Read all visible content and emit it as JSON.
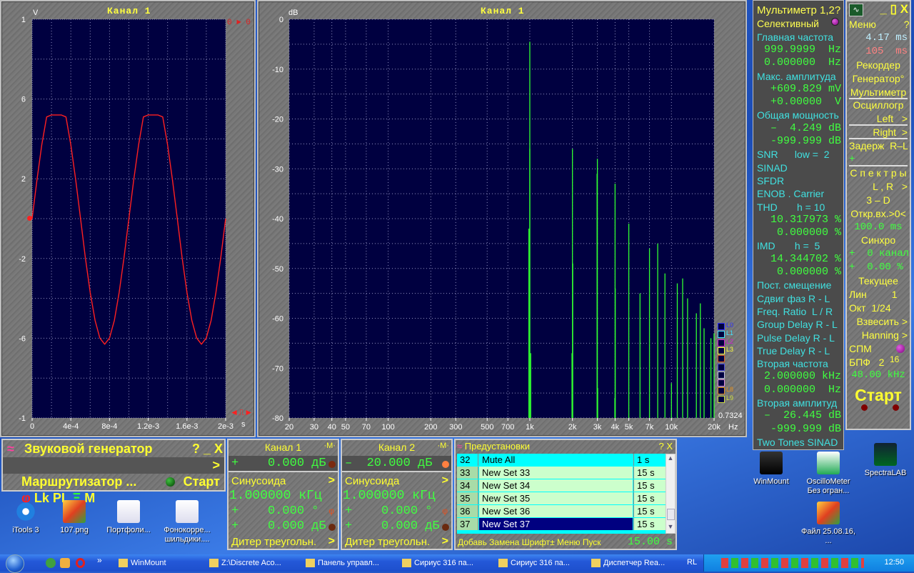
{
  "oscilloscope": {
    "title": "Канал 1",
    "y_unit": "V",
    "x_unit": "s",
    "marker_top": "0 ► 0",
    "marker_bottom": "◄⎍►",
    "trace_color": "#ff2020"
  },
  "spectrum": {
    "title": "Канал 1",
    "y_unit": "dB",
    "x_unit": "Hz",
    "legend": [
      {
        "label": "L0",
        "color": "#3030ff"
      },
      {
        "label": "L1",
        "color": "#40e0ff"
      },
      {
        "label": "L2",
        "color": "#d020d0"
      },
      {
        "label": "L3",
        "color": "#ffff40"
      },
      {
        "label": "",
        "color": "#e06020"
      },
      {
        "label": "",
        "color": "#5050e0"
      },
      {
        "label": "",
        "color": "#c0c0e0"
      },
      {
        "label": "",
        "color": "#e090e0"
      },
      {
        "label": "L8",
        "color": "#e09020"
      },
      {
        "label": "L9",
        "color": "#d0e040"
      }
    ],
    "readout": "0.7324",
    "trace_color": "#30ff30"
  },
  "chart_data": [
    {
      "type": "line",
      "title": "Канал 1",
      "ylabel": "V",
      "xlabel": "s",
      "xlim": [
        0,
        0.002
      ],
      "ylim": [
        -1,
        1
      ],
      "grid": true,
      "x_ticks": [
        "0",
        "4e-4",
        "8e-4",
        "1.2e-3",
        "1.6e-3",
        "2e-3"
      ],
      "x_tick_values": [
        0,
        0.0004,
        0.0008,
        0.0012,
        0.0016,
        0.002
      ],
      "y_ticks": [
        "1",
        "6",
        "2",
        "-2",
        "-6",
        "-1"
      ],
      "y_tick_values": [
        1,
        0.6,
        0.2,
        -0.2,
        -0.6,
        -1
      ],
      "x": [
        0,
        5e-05,
        0.0001,
        0.00015,
        0.0002,
        0.00025,
        0.0003,
        0.00035,
        0.0004,
        0.00045,
        0.0005,
        0.00055,
        0.0006,
        0.00065,
        0.0007,
        0.00075,
        0.0008,
        0.00085,
        0.0009,
        0.00095,
        0.001,
        0.00105,
        0.0011,
        0.00115,
        0.0012,
        0.00125,
        0.0013,
        0.00135,
        0.0014,
        0.00145,
        0.0015,
        0.00155,
        0.0016,
        0.00165,
        0.0017,
        0.00175,
        0.0018,
        0.00185,
        0.0019,
        0.00195,
        0.002
      ],
      "y": [
        0,
        0.195,
        0.37,
        0.51,
        0.52,
        0.52,
        0.52,
        0.51,
        0.37,
        0.195,
        0,
        -0.195,
        -0.37,
        -0.51,
        -0.599,
        -0.63,
        -0.599,
        -0.51,
        -0.37,
        -0.195,
        0,
        0.195,
        0.37,
        0.51,
        0.52,
        0.52,
        0.52,
        0.51,
        0.37,
        0.195,
        0,
        -0.195,
        -0.37,
        -0.51,
        -0.599,
        -0.63,
        -0.599,
        -0.51,
        -0.37,
        -0.195,
        0
      ]
    },
    {
      "type": "bar",
      "title": "Канал 1",
      "ylabel": "dB",
      "xlabel": "Hz",
      "x_scale": "log",
      "xlim": [
        20,
        20000
      ],
      "ylim": [
        -80,
        0
      ],
      "grid": true,
      "y_ticks": [
        "0",
        "-10",
        "-20",
        "-30",
        "-40",
        "-50",
        "-60",
        "-70",
        "-80"
      ],
      "y_tick_values": [
        0,
        -10,
        -20,
        -30,
        -40,
        -50,
        -60,
        -70,
        -80
      ],
      "x_ticks": [
        "20",
        "30",
        "40",
        "50",
        "70",
        "100",
        "200",
        "300",
        "500",
        "700",
        "1k",
        "2k",
        "3k",
        "4k",
        "5k",
        "7k",
        "10k",
        "20k"
      ],
      "x_tick_values": [
        20,
        30,
        40,
        50,
        70,
        100,
        200,
        300,
        500,
        700,
        1000,
        2000,
        3000,
        4000,
        5000,
        7000,
        10000,
        20000
      ],
      "lines": [
        [
          1000,
          -4.5
        ],
        [
          1000,
          -26
        ],
        [
          985,
          -42
        ],
        [
          1015,
          -67
        ],
        [
          2000,
          -26
        ],
        [
          2010,
          -49
        ],
        [
          1985,
          -67
        ],
        [
          3000,
          -28
        ],
        [
          2985,
          -31
        ],
        [
          3015,
          -74
        ],
        [
          4000,
          -33
        ],
        [
          4015,
          -54
        ],
        [
          3985,
          -76
        ],
        [
          5000,
          -41
        ],
        [
          6000,
          -55
        ],
        [
          7000,
          -46
        ],
        [
          8000,
          -45
        ],
        [
          9000,
          -51
        ],
        [
          10000,
          -73
        ],
        [
          11000,
          -53
        ],
        [
          12000,
          -52
        ],
        [
          13000,
          -56
        ],
        [
          15000,
          -59
        ],
        [
          16000,
          -57
        ],
        [
          17000,
          -62
        ],
        [
          19000,
          -64
        ],
        [
          20000,
          -63
        ]
      ]
    }
  ],
  "multimeter": {
    "rows": [
      {
        "t": "Мультиметр 1,2?",
        "k": "title"
      },
      {
        "t": "Селективный",
        "k": "title"
      },
      {
        "t": "Главная частота",
        "k": "label"
      },
      {
        "t": "999.9999  Hz",
        "k": "value"
      },
      {
        "t": "0.000000  Hz",
        "k": "value"
      },
      {
        "t": "Макс. амплитуда",
        "k": "label"
      },
      {
        "t": "+609.829 mV",
        "k": "value"
      },
      {
        "t": "+0.00000  V",
        "k": "value"
      },
      {
        "t": "Общая мощность",
        "k": "label"
      },
      {
        "t": "–  4.249 dB",
        "k": "value"
      },
      {
        "t": "-999.999 dB",
        "k": "value"
      },
      {
        "t": "SNR      low =  2",
        "k": "label"
      },
      {
        "t": "SINAD",
        "k": "label"
      },
      {
        "t": "SFDR",
        "k": "label"
      },
      {
        "t": "ENOB . Carrier",
        "k": "label"
      },
      {
        "t": "THD       h = 10",
        "k": "label"
      },
      {
        "t": "10.317973 %",
        "k": "value"
      },
      {
        "t": "0.000000 %",
        "k": "value"
      },
      {
        "t": "IMD       h =  5",
        "k": "label"
      },
      {
        "t": "14.344702 %",
        "k": "value"
      },
      {
        "t": "0.000000 %",
        "k": "value"
      },
      {
        "t": "Пост. смещение",
        "k": "label"
      },
      {
        "t": "Сдвиг фаз R - L",
        "k": "label"
      },
      {
        "t": "Freq. Ratio  L / R",
        "k": "label"
      },
      {
        "t": "Group Delay R - L",
        "k": "label"
      },
      {
        "t": "Pulse Delay R - L",
        "k": "label"
      },
      {
        "t": "True Delay R - L",
        "k": "label"
      },
      {
        "t": "Вторая частота",
        "k": "label"
      },
      {
        "t": "2.000000 kHz",
        "k": "value"
      },
      {
        "t": "0.000000  Hz",
        "k": "value"
      },
      {
        "t": "Вторая амплитуд",
        "k": "label"
      },
      {
        "t": "–  26.445 dB",
        "k": "value"
      },
      {
        "t": "-999.999 dB",
        "k": "value"
      },
      {
        "t": "Two Tones SINAD",
        "k": "label"
      }
    ],
    "selective_led_color": "#a000a0"
  },
  "menu": {
    "window_controls": "_ ▯ X",
    "rows": [
      {
        "t": "Меню          ?",
        "k": "y",
        "a": "left"
      },
      {
        "t": "4.17 ms",
        "k": "c",
        "a": "right"
      },
      {
        "t": "105  ms",
        "k": "p",
        "a": "right"
      },
      {
        "t": "Рекордер",
        "k": "y",
        "a": "center"
      },
      {
        "t": "Генератор°",
        "k": "y",
        "a": "center"
      },
      {
        "t": "Мультиметр",
        "k": "y",
        "a": "center",
        "sep": true
      },
      {
        "t": "Осциллогр",
        "k": "y",
        "a": "center"
      },
      {
        "t": "Left   >",
        "k": "y",
        "a": "right",
        "sep": true
      },
      {
        "t": "Right  >",
        "k": "y",
        "a": "right",
        "sep": true
      },
      {
        "t": "Задерж  R–L",
        "k": "y",
        "a": "left"
      },
      {
        "t": "+          0",
        "k": "g",
        "a": "left",
        "sep": true
      },
      {
        "t": "С п е к т р ы",
        "k": "y",
        "a": "center"
      },
      {
        "t": "L , R   >",
        "k": "y",
        "a": "right"
      },
      {
        "t": "3 – D",
        "k": "y",
        "a": "center"
      },
      {
        "t": "Откр.вх.>0<",
        "k": "y",
        "a": "center"
      },
      {
        "t": "100.0 ms",
        "k": "g",
        "a": "center"
      },
      {
        "t": "Синхро",
        "k": "y",
        "a": "center"
      },
      {
        "t": "+  0 канал",
        "k": "g",
        "a": "left"
      },
      {
        "t": "+  0.00 %",
        "k": "g",
        "a": "left"
      },
      {
        "t": "Текущее",
        "k": "y",
        "a": "center"
      },
      {
        "t": "Лин         1",
        "k": "y",
        "a": "left"
      },
      {
        "t": "Окт  1/24",
        "k": "y",
        "a": "left"
      },
      {
        "t": "Взвесить >",
        "k": "y",
        "a": "right"
      },
      {
        "t": "Hanning >",
        "k": "y",
        "a": "right"
      },
      {
        "t": "СПМ",
        "k": "y",
        "a": "left"
      },
      {
        "t": "БПФ   2",
        "k": "y",
        "a": "left"
      },
      {
        "t": "48.00 kHz",
        "k": "g",
        "a": "center"
      }
    ],
    "fft_exponent": "16",
    "start_label": "Старт"
  },
  "generator": {
    "title": "Звуковой генератор",
    "controls": "? _ X",
    "router": "Маршрутизатор ...",
    "router_arrow": ">",
    "toolbar": "Lk PL",
    "toolbar_m": "M",
    "start_label": "Старт"
  },
  "channels": [
    {
      "title": "Канал 1",
      "m": "·M·",
      "level": "+    0.000 дБ",
      "wave": "Синусоида",
      "freq": "1.000000 кГц",
      "phase": "+    0.000 °",
      "amp": "+    0.000 дБ",
      "dither": "Дитер треугольн.",
      "led": "#7a2a10"
    },
    {
      "title": "Канал 2",
      "m": "·M·",
      "level": "–  20.000 дБ",
      "wave": "Синусоида",
      "freq": "1.000000 кГц",
      "phase": "+    0.000 °",
      "amp": "+    0.000 дБ",
      "dither": "Дитер треугольн.",
      "led": "#ff8040"
    }
  ],
  "presets": {
    "title": "Предустановки",
    "controls": "? X",
    "rows": [
      {
        "n": "32",
        "name": "Mute All",
        "time": "1 s"
      },
      {
        "n": "33",
        "name": "New Set 33",
        "time": "15 s"
      },
      {
        "n": "34",
        "name": "New Set 34",
        "time": "15 s"
      },
      {
        "n": "35",
        "name": "New Set 35",
        "time": "15 s"
      },
      {
        "n": "36",
        "name": "New Set 36",
        "time": "15 s"
      },
      {
        "n": "37",
        "name": "New Set 37",
        "time": "15 s"
      }
    ],
    "footer": "Добавь Замена Шрифт± Меню Пуск",
    "footer_time": "15.00 s"
  },
  "desktop_icons": [
    {
      "label": "iTools 3",
      "icon": "itools-icon"
    },
    {
      "label": "107.png",
      "icon": "image-icon"
    },
    {
      "label": "Портфоли...",
      "icon": "word-doc-icon"
    },
    {
      "label": "Фонокорре... шильдики....",
      "icon": "word-doc-icon"
    },
    {
      "label": "WinMount",
      "icon": "winmount-icon"
    },
    {
      "label": "OscilloMeter Без огран...",
      "icon": "oscillometer-icon"
    },
    {
      "label": "SpectraLAB",
      "icon": "spectralab-icon"
    },
    {
      "label": "Файл 25.08.16, ...",
      "icon": "image-icon"
    }
  ],
  "taskbar": {
    "items": [
      "WinMount",
      "Z:\\Discrete Aco...",
      "Панель управл...",
      "Сириус 316 па...",
      "Сириус 316 па...",
      "Диспетчер Rea..."
    ],
    "language": "RL",
    "clock": "12:50"
  }
}
